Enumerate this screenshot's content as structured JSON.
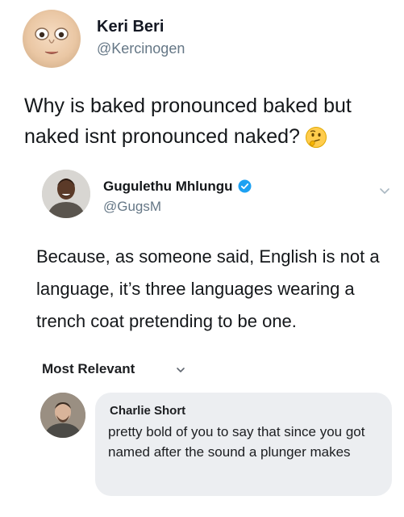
{
  "tweet": {
    "author_name": "Keri Beri",
    "author_handle": "@Kercinogen",
    "text": "Why is baked pronounced baked but naked isnt pronounced naked?",
    "emoji_icon": "thinking-face-emoji"
  },
  "reply_tweet": {
    "author_name": "Gugulethu Mhlungu",
    "author_handle": "@GugsM",
    "verified": true,
    "text": "Because, as someone said, English is not a language, it’s three languages wearing a trench coat pretending to be one.",
    "menu_icon": "chevron-down-icon"
  },
  "comments": {
    "sort_label": "Most Relevant",
    "sort_icon": "chevron-down-icon",
    "items": [
      {
        "author": "Charlie Short",
        "text": "pretty bold of you to say that since you got named after the sound a plunger makes"
      }
    ]
  },
  "colors": {
    "verified_blue": "#1da1f2",
    "handle_gray": "#657786",
    "bubble_bg": "#eceef1"
  }
}
